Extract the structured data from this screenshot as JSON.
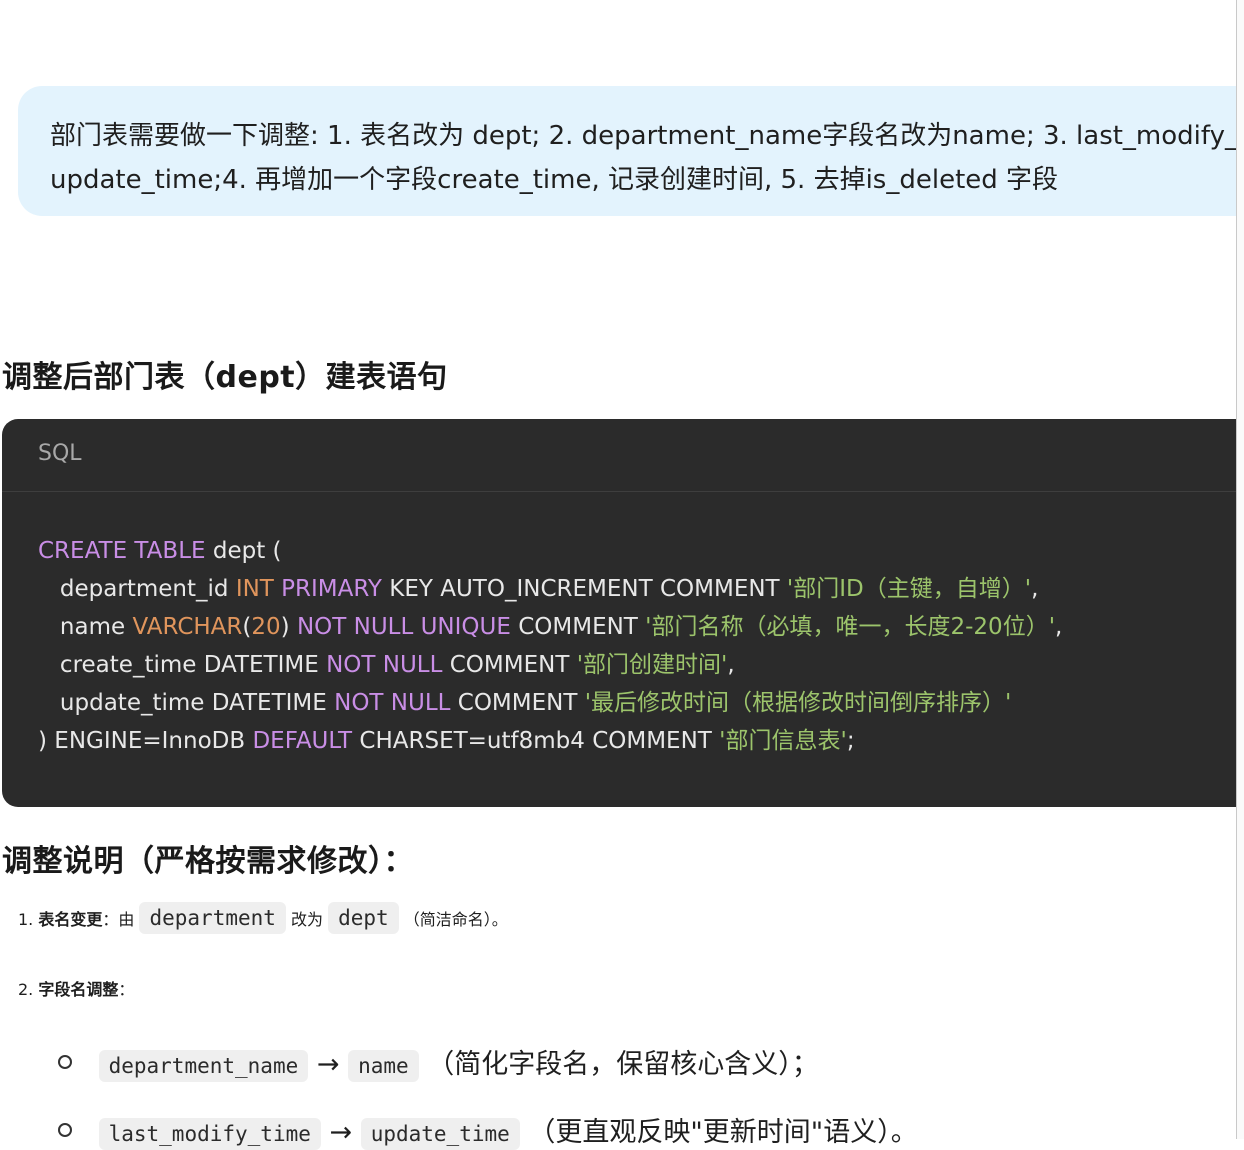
{
  "user_message": {
    "line1": "部门表需要做一下调整: 1. 表名改为 dept; 2. department_name字段名改为name; 3.     last_modify_",
    "line2": "update_time;4. 再增加一个字段create_time, 记录创建时间, 5. 去掉is_deleted 字段"
  },
  "section1_title": "调整后部门表（dept）建表语句",
  "code": {
    "language": "SQL",
    "lines": [
      [
        {
          "t": "CREATE TABLE",
          "c": "kw"
        },
        {
          "t": " dept (",
          "c": ""
        }
      ],
      [
        {
          "t": "   department_id ",
          "c": ""
        },
        {
          "t": "INT",
          "c": "ty"
        },
        {
          "t": " ",
          "c": ""
        },
        {
          "t": "PRIMARY",
          "c": "kw"
        },
        {
          "t": " KEY AUTO_INCREMENT COMMENT ",
          "c": ""
        },
        {
          "t": "'部门ID（主键，自增）'",
          "c": "st"
        },
        {
          "t": ",",
          "c": ""
        }
      ],
      [
        {
          "t": "   name ",
          "c": ""
        },
        {
          "t": "VARCHAR",
          "c": "ty"
        },
        {
          "t": "(",
          "c": ""
        },
        {
          "t": "20",
          "c": "nm"
        },
        {
          "t": ") ",
          "c": ""
        },
        {
          "t": "NOT NULL UNIQUE",
          "c": "kw"
        },
        {
          "t": " COMMENT ",
          "c": ""
        },
        {
          "t": "'部门名称（必填，唯一，长度2-20位）'",
          "c": "st"
        },
        {
          "t": ",",
          "c": ""
        }
      ],
      [
        {
          "t": "   create_time DATETIME ",
          "c": ""
        },
        {
          "t": "NOT NULL",
          "c": "kw"
        },
        {
          "t": " COMMENT ",
          "c": ""
        },
        {
          "t": "'部门创建时间'",
          "c": "st"
        },
        {
          "t": ",",
          "c": ""
        }
      ],
      [
        {
          "t": "   update_time DATETIME ",
          "c": ""
        },
        {
          "t": "NOT NULL",
          "c": "kw"
        },
        {
          "t": " COMMENT ",
          "c": ""
        },
        {
          "t": "'最后修改时间（根据修改时间倒序排序）'",
          "c": "st"
        }
      ],
      [
        {
          "t": ") ENGINE=InnoDB ",
          "c": ""
        },
        {
          "t": "DEFAULT",
          "c": "kw"
        },
        {
          "t": " CHARSET=utf8mb4 COMMENT ",
          "c": ""
        },
        {
          "t": "'部门信息表'",
          "c": "st"
        },
        {
          "t": ";",
          "c": ""
        }
      ]
    ]
  },
  "section2_title": "调整说明（严格按需求修改）：",
  "notes": {
    "item1": {
      "num": "1.",
      "bold": "表名变更",
      "colon": "：由",
      "code1": "department",
      "mid": "改为",
      "code2": "dept",
      "tail": "（简洁命名）。"
    },
    "item2": {
      "num": "2.",
      "bold": "字段名调整",
      "colon": "："
    },
    "sub1": {
      "code1": "department_name",
      "arrow": "→",
      "code2": "name",
      "tail": "（简化字段名，保留核心含义）；"
    },
    "sub2": {
      "code1": "last_modify_time",
      "arrow": "→",
      "code2": "update_time",
      "tail": "（更直观反映\"更新时间\"语义）。"
    }
  }
}
